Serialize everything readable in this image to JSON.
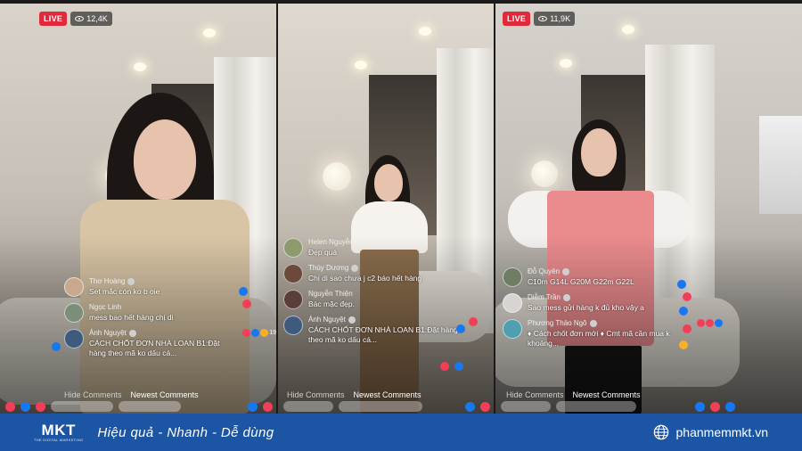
{
  "panels": [
    {
      "live_label": "LIVE",
      "viewers": "12,4K",
      "comments": [
        {
          "name": "Thơ Hoàng",
          "text": "Set mắc còn ko b oie"
        },
        {
          "name": "Ngọc Linh",
          "text": "mess bao hết hàng chị di"
        },
        {
          "name": "Ánh Nguyệt",
          "text": "CÁCH CHỐT ĐƠN NHÀ LOAN B1:Đặt hàng theo mã ko dấu cá..."
        }
      ],
      "react_count": "19",
      "tabs": {
        "hide": "Hide Comments",
        "newest": "Newest Comments"
      }
    },
    {
      "comments": [
        {
          "name": "Helen Nguyễn",
          "text": "Đẹp quá"
        },
        {
          "name": "Thùy Dương",
          "text": "Chị di sao chưa j c2 báo hết hàng"
        },
        {
          "name": "Nguyễn Thiện",
          "text": "Bác mặc đẹp."
        },
        {
          "name": "Ánh Nguyệt",
          "text": "CÁCH CHỐT ĐƠN NHÀ LOAN B1:Đặt hàng theo mã ko dấu cá..."
        }
      ],
      "tabs": {
        "hide": "Hide Comments",
        "newest": "Newest Comments"
      }
    },
    {
      "live_label": "LIVE",
      "viewers": "11,9K",
      "comments": [
        {
          "name": "Đỗ Quyên",
          "text": "C10m G14L G20M G22m G22L"
        },
        {
          "name": "Diễm Trần",
          "text": "Sao mess gửi hàng k đủ kho vậy a"
        },
        {
          "name": "Phương Thảo Ngô",
          "text": "♦ Cách chốt đơn mới ♦ Cmt mã cần mua k khoảng..."
        }
      ],
      "tabs": {
        "hide": "Hide Comments",
        "newest": "Newest Comments"
      }
    }
  ],
  "footer": {
    "logo": "MKT",
    "logo_sub": "THE DIGITAL MARKETING",
    "tagline": "Hiệu quả - Nhanh - Dễ dùng",
    "website": "phanmemmkt.vn",
    "color": "#1d55a5"
  },
  "icons": [
    "eye-icon",
    "globe-icon",
    "like-icon",
    "heart-icon",
    "haha-icon"
  ],
  "colors": {
    "live": "#e02a3b",
    "like": "#1877f2",
    "heart": "#f33e58",
    "haha": "#f7b125"
  }
}
